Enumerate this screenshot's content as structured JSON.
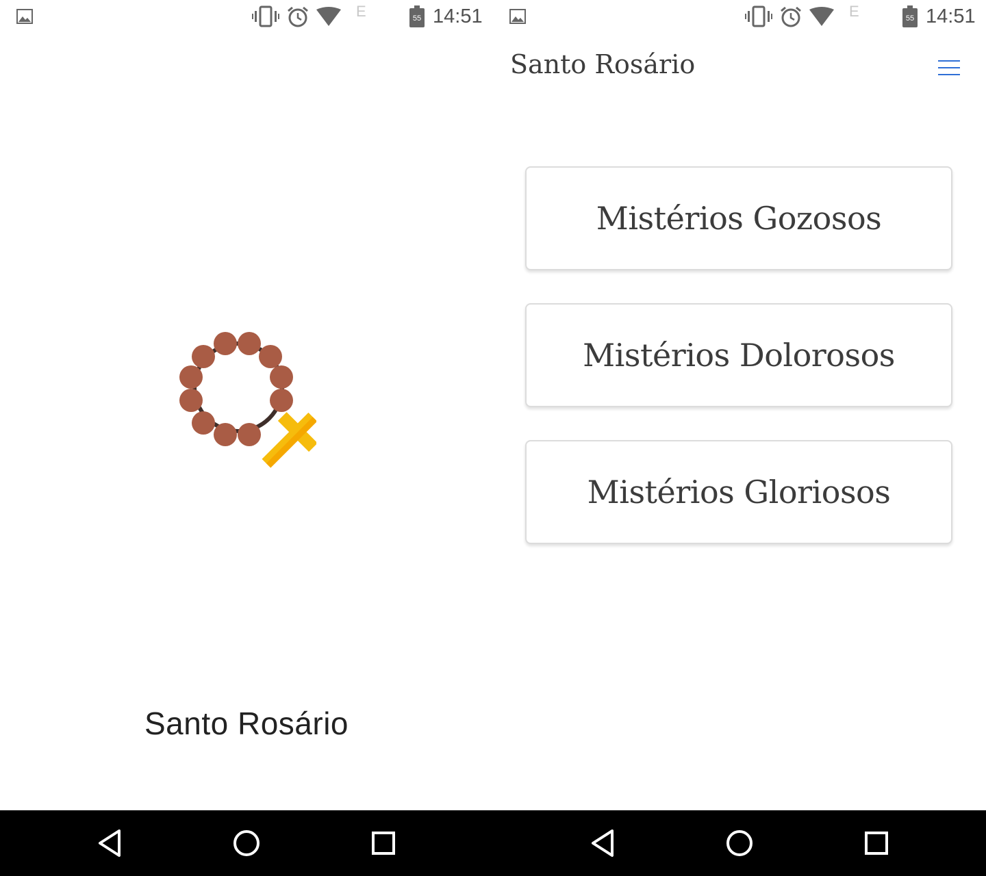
{
  "status_bar": {
    "time": "14:51",
    "network": "E",
    "battery_level": "55",
    "icons": [
      "gallery-notification-icon",
      "vibrate-icon",
      "alarm-icon",
      "wifi-icon",
      "battery-icon"
    ]
  },
  "splash": {
    "title": "Santo Rosário",
    "logo_icon": "rosary-icon",
    "colors": {
      "bead": "#a95c45",
      "cross": "#f6bc0d",
      "cord": "#3e2e2a"
    }
  },
  "app": {
    "header": {
      "title": "Santo Rosário",
      "menu_icon": "hamburger-menu-icon",
      "menu_color": "#2f6fd6"
    },
    "mysteries": [
      {
        "label": "Mistérios Gozosos"
      },
      {
        "label": "Mistérios Dolorosos"
      },
      {
        "label": "Mistérios Gloriosos"
      }
    ]
  },
  "nav_bar": {
    "buttons": [
      "back-icon",
      "home-icon",
      "recents-icon"
    ]
  }
}
